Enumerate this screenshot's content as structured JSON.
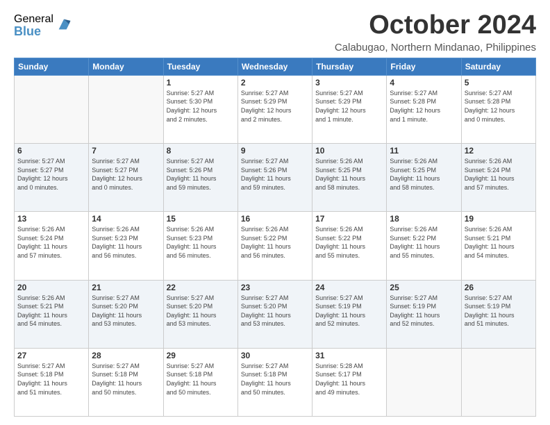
{
  "logo": {
    "general": "General",
    "blue": "Blue"
  },
  "header": {
    "month": "October 2024",
    "location": "Calabugao, Northern Mindanao, Philippines"
  },
  "weekdays": [
    "Sunday",
    "Monday",
    "Tuesday",
    "Wednesday",
    "Thursday",
    "Friday",
    "Saturday"
  ],
  "days": [
    {
      "date": "",
      "info": ""
    },
    {
      "date": "",
      "info": ""
    },
    {
      "date": "1",
      "info": "Sunrise: 5:27 AM\nSunset: 5:30 PM\nDaylight: 12 hours\nand 2 minutes."
    },
    {
      "date": "2",
      "info": "Sunrise: 5:27 AM\nSunset: 5:29 PM\nDaylight: 12 hours\nand 2 minutes."
    },
    {
      "date": "3",
      "info": "Sunrise: 5:27 AM\nSunset: 5:29 PM\nDaylight: 12 hours\nand 1 minute."
    },
    {
      "date": "4",
      "info": "Sunrise: 5:27 AM\nSunset: 5:28 PM\nDaylight: 12 hours\nand 1 minute."
    },
    {
      "date": "5",
      "info": "Sunrise: 5:27 AM\nSunset: 5:28 PM\nDaylight: 12 hours\nand 0 minutes."
    },
    {
      "date": "6",
      "info": "Sunrise: 5:27 AM\nSunset: 5:27 PM\nDaylight: 12 hours\nand 0 minutes."
    },
    {
      "date": "7",
      "info": "Sunrise: 5:27 AM\nSunset: 5:27 PM\nDaylight: 12 hours\nand 0 minutes."
    },
    {
      "date": "8",
      "info": "Sunrise: 5:27 AM\nSunset: 5:26 PM\nDaylight: 11 hours\nand 59 minutes."
    },
    {
      "date": "9",
      "info": "Sunrise: 5:27 AM\nSunset: 5:26 PM\nDaylight: 11 hours\nand 59 minutes."
    },
    {
      "date": "10",
      "info": "Sunrise: 5:26 AM\nSunset: 5:25 PM\nDaylight: 11 hours\nand 58 minutes."
    },
    {
      "date": "11",
      "info": "Sunrise: 5:26 AM\nSunset: 5:25 PM\nDaylight: 11 hours\nand 58 minutes."
    },
    {
      "date": "12",
      "info": "Sunrise: 5:26 AM\nSunset: 5:24 PM\nDaylight: 11 hours\nand 57 minutes."
    },
    {
      "date": "13",
      "info": "Sunrise: 5:26 AM\nSunset: 5:24 PM\nDaylight: 11 hours\nand 57 minutes."
    },
    {
      "date": "14",
      "info": "Sunrise: 5:26 AM\nSunset: 5:23 PM\nDaylight: 11 hours\nand 56 minutes."
    },
    {
      "date": "15",
      "info": "Sunrise: 5:26 AM\nSunset: 5:23 PM\nDaylight: 11 hours\nand 56 minutes."
    },
    {
      "date": "16",
      "info": "Sunrise: 5:26 AM\nSunset: 5:22 PM\nDaylight: 11 hours\nand 56 minutes."
    },
    {
      "date": "17",
      "info": "Sunrise: 5:26 AM\nSunset: 5:22 PM\nDaylight: 11 hours\nand 55 minutes."
    },
    {
      "date": "18",
      "info": "Sunrise: 5:26 AM\nSunset: 5:22 PM\nDaylight: 11 hours\nand 55 minutes."
    },
    {
      "date": "19",
      "info": "Sunrise: 5:26 AM\nSunset: 5:21 PM\nDaylight: 11 hours\nand 54 minutes."
    },
    {
      "date": "20",
      "info": "Sunrise: 5:26 AM\nSunset: 5:21 PM\nDaylight: 11 hours\nand 54 minutes."
    },
    {
      "date": "21",
      "info": "Sunrise: 5:27 AM\nSunset: 5:20 PM\nDaylight: 11 hours\nand 53 minutes."
    },
    {
      "date": "22",
      "info": "Sunrise: 5:27 AM\nSunset: 5:20 PM\nDaylight: 11 hours\nand 53 minutes."
    },
    {
      "date": "23",
      "info": "Sunrise: 5:27 AM\nSunset: 5:20 PM\nDaylight: 11 hours\nand 53 minutes."
    },
    {
      "date": "24",
      "info": "Sunrise: 5:27 AM\nSunset: 5:19 PM\nDaylight: 11 hours\nand 52 minutes."
    },
    {
      "date": "25",
      "info": "Sunrise: 5:27 AM\nSunset: 5:19 PM\nDaylight: 11 hours\nand 52 minutes."
    },
    {
      "date": "26",
      "info": "Sunrise: 5:27 AM\nSunset: 5:19 PM\nDaylight: 11 hours\nand 51 minutes."
    },
    {
      "date": "27",
      "info": "Sunrise: 5:27 AM\nSunset: 5:18 PM\nDaylight: 11 hours\nand 51 minutes."
    },
    {
      "date": "28",
      "info": "Sunrise: 5:27 AM\nSunset: 5:18 PM\nDaylight: 11 hours\nand 50 minutes."
    },
    {
      "date": "29",
      "info": "Sunrise: 5:27 AM\nSunset: 5:18 PM\nDaylight: 11 hours\nand 50 minutes."
    },
    {
      "date": "30",
      "info": "Sunrise: 5:27 AM\nSunset: 5:18 PM\nDaylight: 11 hours\nand 50 minutes."
    },
    {
      "date": "31",
      "info": "Sunrise: 5:28 AM\nSunset: 5:17 PM\nDaylight: 11 hours\nand 49 minutes."
    },
    {
      "date": "",
      "info": ""
    },
    {
      "date": "",
      "info": ""
    }
  ]
}
